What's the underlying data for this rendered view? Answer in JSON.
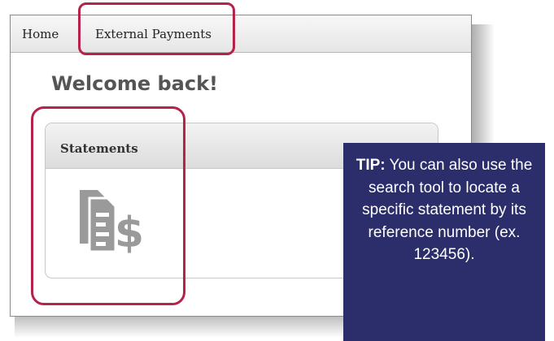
{
  "nav": {
    "items": [
      {
        "label": "Home"
      },
      {
        "label": "External Payments"
      }
    ]
  },
  "main": {
    "welcome": "Welcome back!",
    "card": {
      "title": "Statements",
      "icon": "statement-dollar-icon"
    }
  },
  "tip": {
    "label": "TIP:",
    "text": "You can also use the search tool to locate a specific statement by its reference number (ex. 123456)."
  },
  "colors": {
    "highlight": "#b5234b",
    "tip_background": "#2b2e6a",
    "welcome_text": "#555555",
    "icon": "#9a9a9a"
  }
}
